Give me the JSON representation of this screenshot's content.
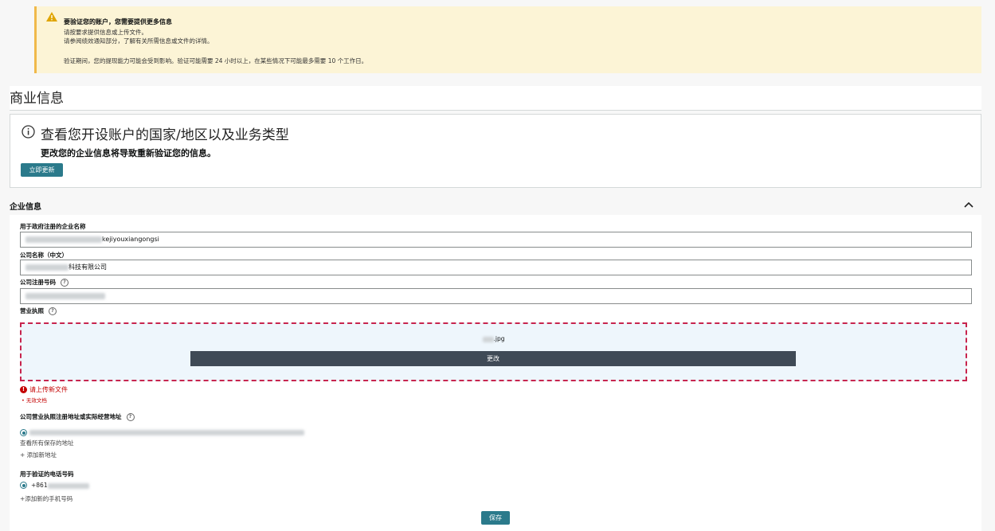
{
  "banner": {
    "title": "要验证您的账户，您需要提供更多信息",
    "line1": "请按要求提供信息或上传文件。",
    "line2": "请参阅绩效通知部分，了解有关所需信息或文件的详情。",
    "line3": "验证期间，您的提现能力可能会受到影响。验证可能需要 24 小时以上，在某些情况下可能最多需要 10 个工作日。"
  },
  "section": {
    "title": "商业信息"
  },
  "info": {
    "heading": "查看您开设账户的国家/地区以及业务类型",
    "subtext": "更改您的企业信息将导致重新验证您的信息。",
    "update_button": "立即更新"
  },
  "enterprise": {
    "label": "企业信息",
    "gov_name_label": "用于政府注册的企业名称",
    "gov_name_value": "kejiyouxiangongsi",
    "cn_name_label": "公司名称（中文）",
    "cn_name_value": "科技有限公司",
    "reg_no_label": "公司注册号码",
    "license_label": "营业执照",
    "file_name": ".jpg",
    "change_button": "更改",
    "error_title": "请上传新文件",
    "error_detail": "无效文档",
    "address_label": "公司营业执照注册地址或实际经营地址",
    "view_addresses": "查看所有保存的地址",
    "add_address": "+ 添加新地址",
    "phone_label": "用于验证的电话号码",
    "phone_prefix": "+861",
    "add_phone": "+添加新的手机号码",
    "save_button": "保存"
  },
  "colors": {
    "accent": "#2b7a8b",
    "error": "#c40000",
    "warning_bg": "#fcf4d6"
  },
  "icons": [
    "warning-icon",
    "info-icon",
    "chevron-up-icon",
    "help-icon",
    "error-icon"
  ]
}
